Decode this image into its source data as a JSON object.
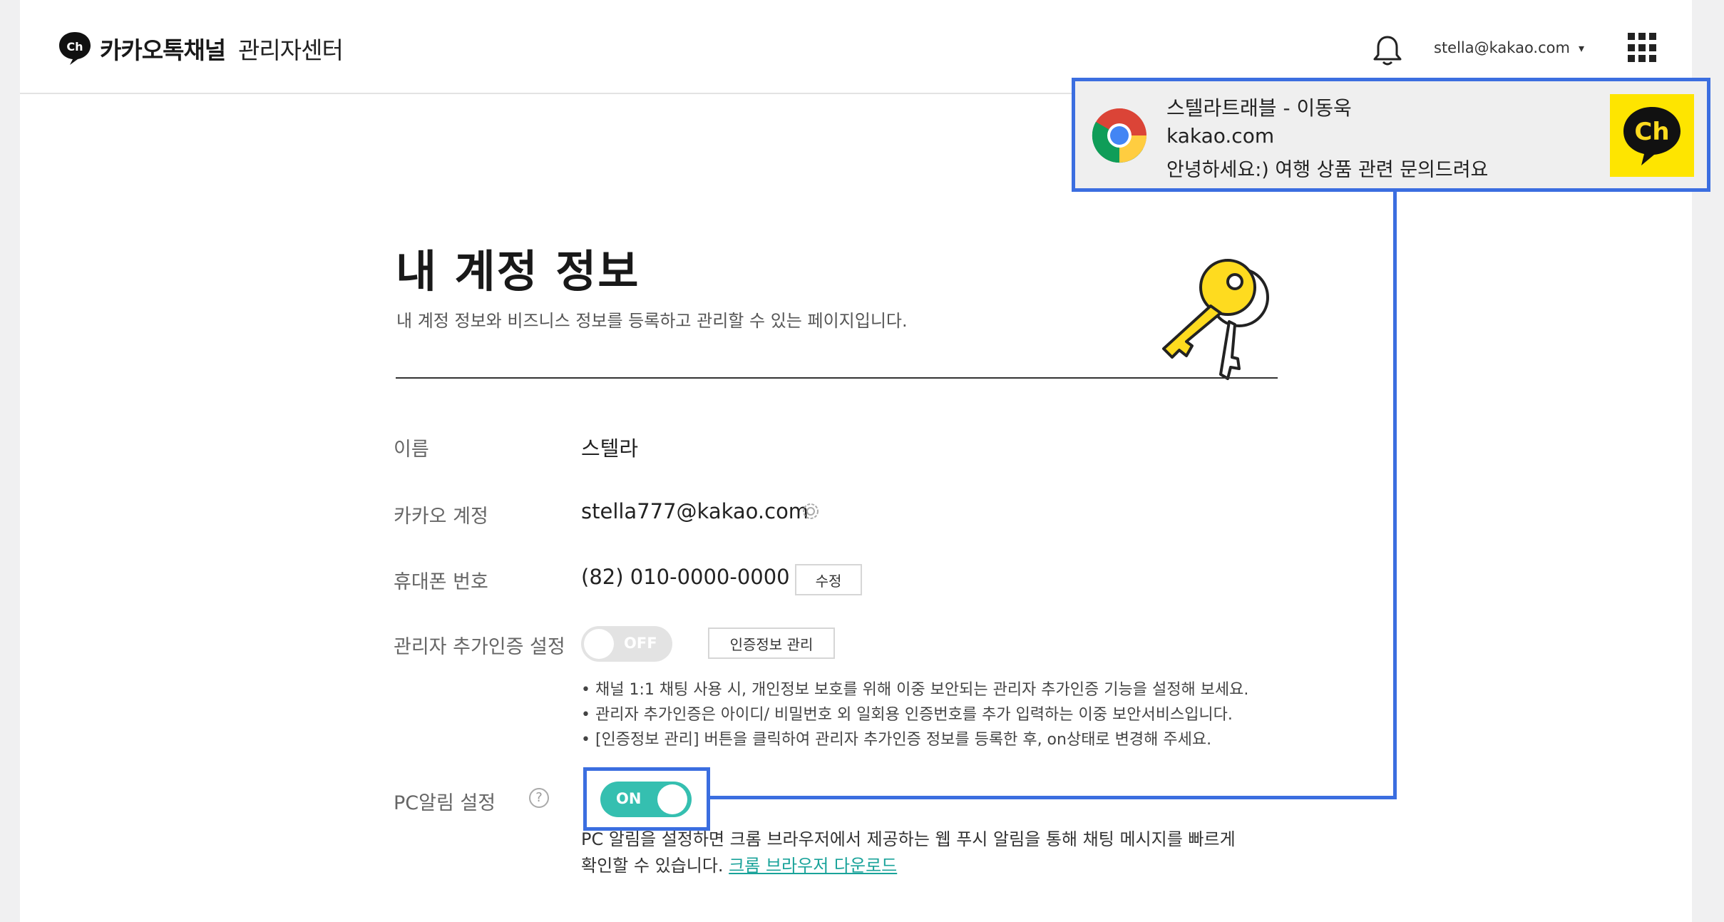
{
  "header": {
    "logo_icon": "kakao-channel-ch-icon",
    "brand": "카카오톡채널",
    "brand_sub": "관리자센터",
    "notification_icon": "bell-icon",
    "user_email": "stella@kakao.com",
    "user_caret": "▾",
    "apps_icon": "grid-apps-icon"
  },
  "page": {
    "title": "내 계정 정보",
    "subtitle": "내 계정 정보와 비즈니스 정보를 등록하고 관리할 수 있는 페이지입니다."
  },
  "fields": {
    "name_label": "이름",
    "name_value": "스텔라",
    "account_label": "카카오 계정",
    "account_value": "stella777@kakao.com",
    "phone_label": "휴대폰 번호",
    "phone_value": "(82) 010-0000-0000",
    "phone_edit": "수정",
    "twofa_label": "관리자 추가인증 설정",
    "twofa_state": "OFF",
    "twofa_manage": "인증정보 관리",
    "twofa_notes": [
      "• 채널 1:1 채팅 사용 시, 개인정보 보호를 위해 이중 보안되는 관리자 추가인증 기능을 설정해 보세요.",
      "• 관리자 추가인증은 아이디/ 비밀번호 외 일회용 인증번호를 추가 입력하는 이중 보안서비스입니다.",
      "• [인증정보 관리] 버튼을 클릭하여 관리자 추가인증 정보를 등록한 후, on상태로 변경해 주세요."
    ],
    "pc_label": "PC알림 설정",
    "pc_help": "?",
    "pc_state": "ON",
    "pc_desc_line1": "PC 알림을 설정하면 크롬 브라우저에서 제공하는 웹 푸시 알림을 통해 채팅 메시지를 빠르게",
    "pc_desc_line2": "확인할 수 있습니다.",
    "pc_link": "크롬 브라우저 다운로드"
  },
  "notification": {
    "title": "스텔라트래블 - 이동욱",
    "site": "kakao.com",
    "message": "안녕하세요:) 여행 상품 관련 문의드려요",
    "browser_icon": "chrome-icon",
    "channel_icon": "kakao-channel-ch-icon"
  },
  "colors": {
    "highlight": "#3b6ee0",
    "toggle_on": "#35bfb0",
    "kakao_yellow": "#fee500",
    "link": "#1aa39a"
  }
}
